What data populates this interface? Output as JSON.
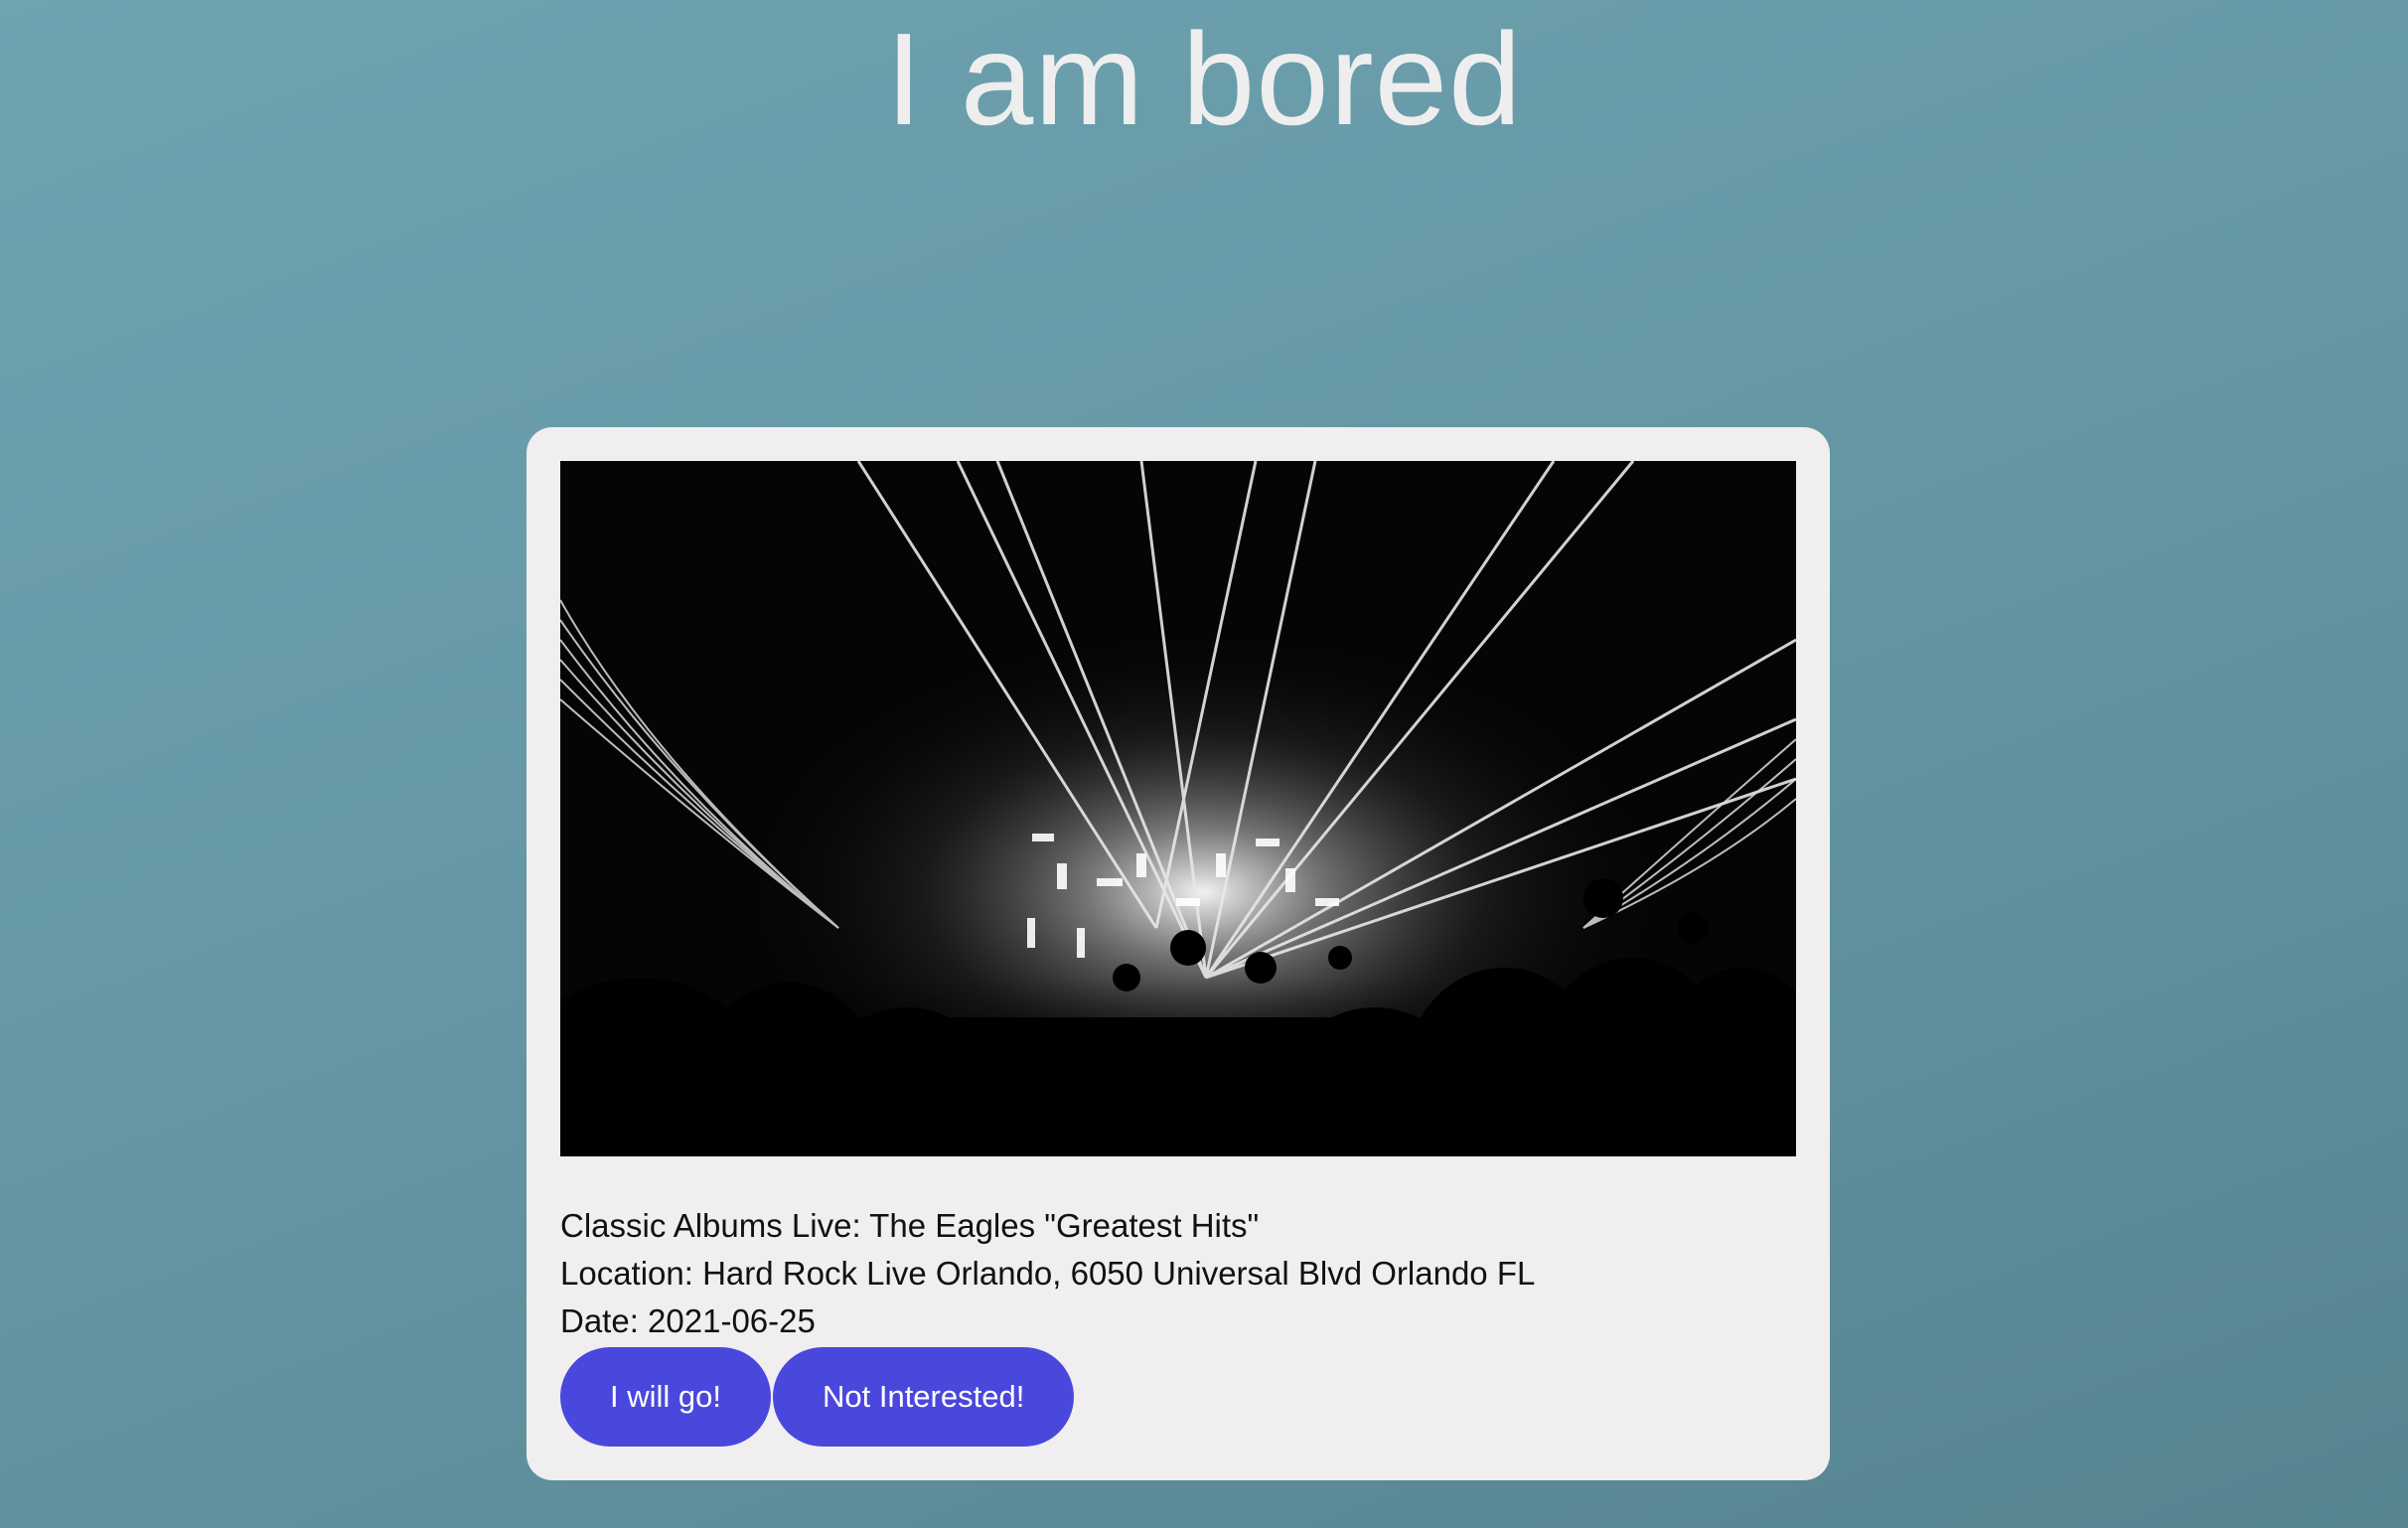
{
  "page": {
    "title": "I am bored"
  },
  "event": {
    "name": "Classic Albums Live: The Eagles \"Greatest Hits\"",
    "location": "Location: Hard Rock Live Orlando, 6050 Universal Blvd Orlando FL",
    "date": "Date: 2021-06-25"
  },
  "actions": {
    "go_label": "I will go!",
    "decline_label": "Not Interested!"
  },
  "colors": {
    "background": "#6597a5",
    "card": "#f0eeef",
    "button": "#4a48dc",
    "title": "#eeeeee"
  }
}
